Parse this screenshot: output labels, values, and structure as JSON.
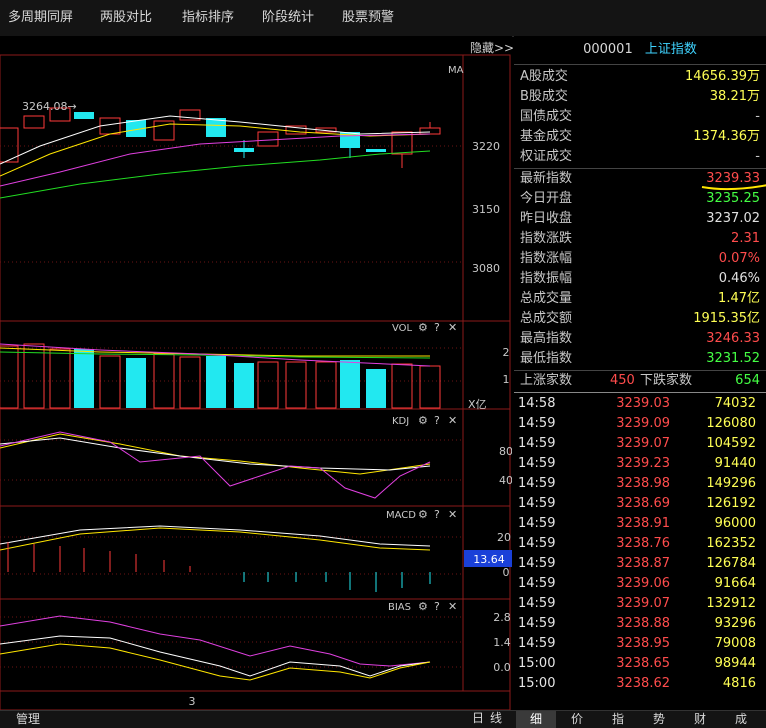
{
  "menu": [
    "多周期同屏",
    "两股对比",
    "指标排序",
    "阶段统计",
    "股票预警"
  ],
  "hide_label": "隐藏>>",
  "chart": {
    "ma_label": "MA",
    "high_marker": "3264.08→",
    "price_ticks": [
      "3220",
      "3150",
      "3080"
    ],
    "vol_label": "VOL",
    "vol_ticks": [
      "2",
      "1"
    ],
    "vol_unit": "X亿",
    "kdj_label": "KDJ",
    "kdj_ticks": [
      "80",
      "40"
    ],
    "macd_label": "MACD",
    "macd_ticks": [
      "20",
      "0"
    ],
    "macd_value": "13.64",
    "bias_label": "BIAS",
    "bias_ticks": [
      "2.8",
      "1.4",
      "0.0"
    ],
    "x_tick": "3",
    "panel_icons": {
      "gear": "gear-icon",
      "question": "?",
      "close": "✕"
    }
  },
  "stock": {
    "code": "000001",
    "name": "上证指数"
  },
  "stats_top": [
    {
      "label": "A股成交",
      "value": "14656.39万",
      "color": "#ffff55"
    },
    {
      "label": "B股成交",
      "value": "38.21万",
      "color": "#ffff55"
    },
    {
      "label": "国债成交",
      "value": "-",
      "color": "#c8c8c8"
    },
    {
      "label": "基金成交",
      "value": "1374.36万",
      "color": "#ffff55"
    },
    {
      "label": "权证成交",
      "value": "-",
      "color": "#c8c8c8"
    }
  ],
  "stats_mid": [
    {
      "label": "最新指数",
      "value": "3239.33",
      "color": "#ff4c4c"
    },
    {
      "label": "今日开盘",
      "value": "3235.25",
      "color": "#44ff44"
    },
    {
      "label": "昨日收盘",
      "value": "3237.02",
      "color": "#e0e0e0"
    },
    {
      "label": "指数涨跌",
      "value": "2.31",
      "color": "#ff4c4c"
    },
    {
      "label": "指数涨幅",
      "value": "0.07%",
      "color": "#ff4c4c"
    },
    {
      "label": "指数振幅",
      "value": "0.46%",
      "color": "#e0e0e0"
    },
    {
      "label": "总成交量",
      "value": "1.47亿",
      "color": "#ffff55"
    },
    {
      "label": "总成交额",
      "value": "1915.35亿",
      "color": "#ffff55"
    },
    {
      "label": "最高指数",
      "value": "3246.33",
      "color": "#ff4c4c"
    },
    {
      "label": "最低指数",
      "value": "3231.52",
      "color": "#44ff44"
    }
  ],
  "updown": {
    "up_label": "上涨家数",
    "up_value": "450",
    "down_label": "下跌家数",
    "down_value": "654"
  },
  "ticks": [
    {
      "time": "14:58",
      "price": "3239.03",
      "vol": "74032"
    },
    {
      "time": "14:59",
      "price": "3239.09",
      "vol": "126080"
    },
    {
      "time": "14:59",
      "price": "3239.07",
      "vol": "104592"
    },
    {
      "time": "14:59",
      "price": "3239.23",
      "vol": "91440"
    },
    {
      "time": "14:59",
      "price": "3238.98",
      "vol": "149296"
    },
    {
      "time": "14:59",
      "price": "3238.69",
      "vol": "126192"
    },
    {
      "time": "14:59",
      "price": "3238.91",
      "vol": "96000"
    },
    {
      "time": "14:59",
      "price": "3238.76",
      "vol": "162352"
    },
    {
      "time": "14:59",
      "price": "3238.87",
      "vol": "126784"
    },
    {
      "time": "14:59",
      "price": "3239.06",
      "vol": "91664"
    },
    {
      "time": "14:59",
      "price": "3239.07",
      "vol": "132912"
    },
    {
      "time": "14:59",
      "price": "3238.88",
      "vol": "93296"
    },
    {
      "time": "14:59",
      "price": "3238.95",
      "vol": "79008"
    },
    {
      "time": "15:00",
      "price": "3238.65",
      "vol": "98944"
    },
    {
      "time": "15:00",
      "price": "3238.62",
      "vol": "4816"
    }
  ],
  "bottom": {
    "manage_label": "管理",
    "day_label": "日",
    "line_label": "线",
    "tabs": [
      "细",
      "价",
      "指",
      "势",
      "财",
      "成"
    ]
  }
}
